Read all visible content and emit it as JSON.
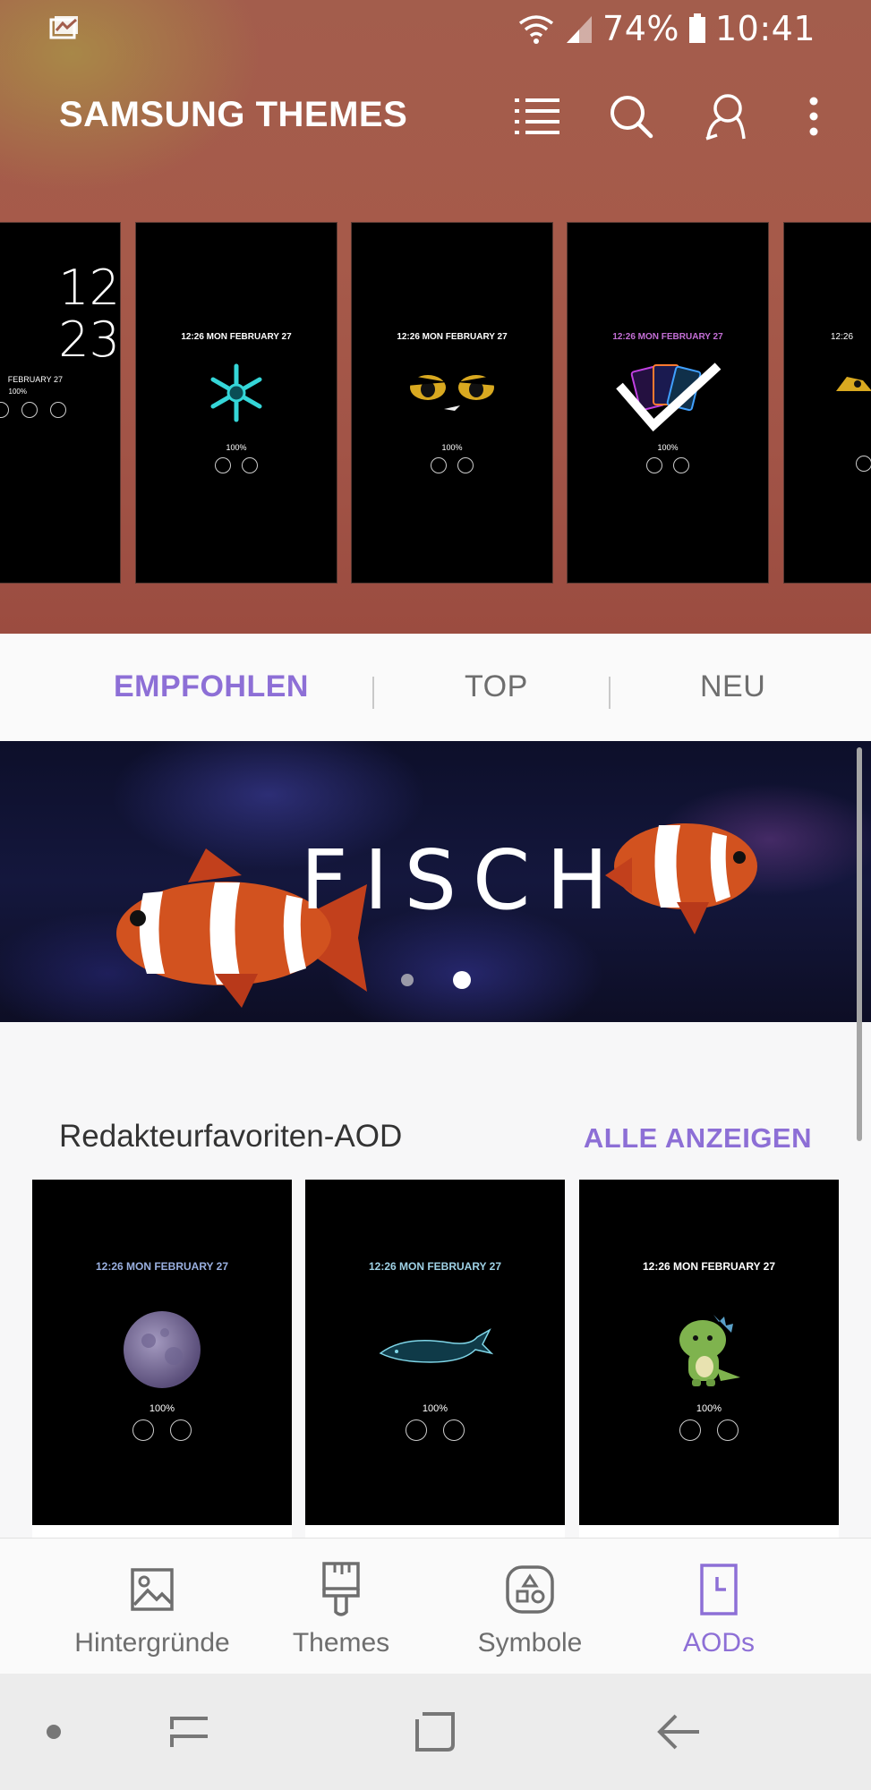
{
  "status_bar": {
    "battery": "74%",
    "time": "10:41"
  },
  "app_bar": {
    "title": "SAMSUNG THEMES",
    "actions": [
      "list-icon",
      "search-icon",
      "user-search-icon",
      "more-vert-icon"
    ]
  },
  "carousel": {
    "cards": [
      {
        "date": "",
        "battery": "100%",
        "art": "clock-12-23",
        "clock": [
          "12",
          "23"
        ],
        "small_date": "FEBRUARY 27"
      },
      {
        "date": "12:26  MON FEBRUARY 27",
        "battery": "100%",
        "art": "snowflake"
      },
      {
        "date": "12:26  MON FEBRUARY 27",
        "battery": "100%",
        "art": "owl-eyes"
      },
      {
        "date": "12:26  MON FEBRUARY 27",
        "battery": "100%",
        "art": "cards",
        "selected": true
      },
      {
        "date": "12:26",
        "battery": "",
        "art": "partial"
      }
    ]
  },
  "tabs": [
    {
      "label": "EMPFOHLEN",
      "active": true
    },
    {
      "label": "TOP",
      "active": false
    },
    {
      "label": "NEU",
      "active": false
    }
  ],
  "banner": {
    "title": "FISCH",
    "page": 2,
    "pages": 2
  },
  "section": {
    "title": "Redakteurfavoriten-AOD",
    "link": "ALLE ANZEIGEN",
    "cards": [
      {
        "date": "12:26  MON FEBRUARY 27",
        "battery": "100%",
        "art": "moon"
      },
      {
        "date": "12:26  MON FEBRUARY 27",
        "battery": "100%",
        "art": "whale"
      },
      {
        "date": "12:26  MON FEBRUARY 27",
        "battery": "100%",
        "art": "dinosaur"
      }
    ]
  },
  "bottom_nav": [
    {
      "label": "Hintergründe",
      "icon": "image-icon",
      "active": false
    },
    {
      "label": "Themes",
      "icon": "brush-icon",
      "active": false
    },
    {
      "label": "Symbole",
      "icon": "shapes-icon",
      "active": false
    },
    {
      "label": "AODs",
      "icon": "aod-icon",
      "active": true
    }
  ],
  "colors": {
    "accent": "#8d6fd6",
    "inactive": "#6e6e6e"
  }
}
